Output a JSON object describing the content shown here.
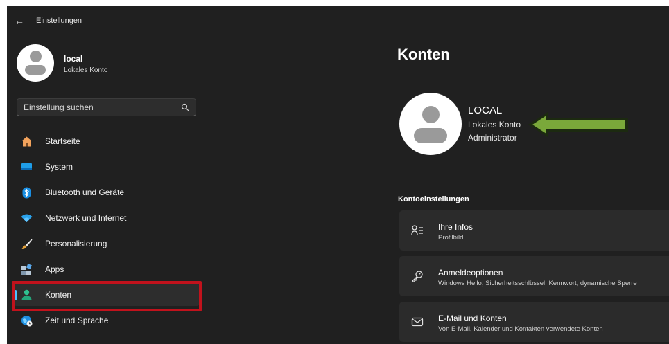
{
  "titlebar": {
    "back_glyph": "←",
    "title": "Einstellungen"
  },
  "profile": {
    "name": "local",
    "account_type": "Lokales Konto"
  },
  "search": {
    "placeholder": "Einstellung suchen"
  },
  "nav": {
    "items": [
      {
        "label": "Startseite",
        "icon": "home-icon"
      },
      {
        "label": "System",
        "icon": "monitor-icon"
      },
      {
        "label": "Bluetooth und Geräte",
        "icon": "bluetooth-icon"
      },
      {
        "label": "Netzwerk und Internet",
        "icon": "wifi-icon"
      },
      {
        "label": "Personalisierung",
        "icon": "brush-icon"
      },
      {
        "label": "Apps",
        "icon": "apps-icon"
      },
      {
        "label": "Konten",
        "icon": "user-icon",
        "active": true
      },
      {
        "label": "Zeit und Sprache",
        "icon": "globe-clock-icon"
      }
    ]
  },
  "main": {
    "title": "Konten",
    "account": {
      "name": "LOCAL",
      "type": "Lokales Konto",
      "role": "Administrator"
    },
    "section_title": "Kontoeinstellungen",
    "cards": [
      {
        "title": "Ihre Infos",
        "subtitle": "Profilbild",
        "icon": "person-lines-icon"
      },
      {
        "title": "Anmeldeoptionen",
        "subtitle": "Windows Hello, Sicherheitsschlüssel, Kennwort, dynamische Sperre",
        "icon": "key-icon"
      },
      {
        "title": "E-Mail und Konten",
        "subtitle": "Von E-Mail, Kalender und Kontakten verwendete Konten",
        "icon": "mail-icon"
      }
    ]
  },
  "colors": {
    "window_bg": "#202020",
    "card_bg": "#2b2b2b",
    "accent": "#4cc2ff",
    "highlight_box": "#c1121c",
    "annotation_arrow": "#7aa83a"
  }
}
